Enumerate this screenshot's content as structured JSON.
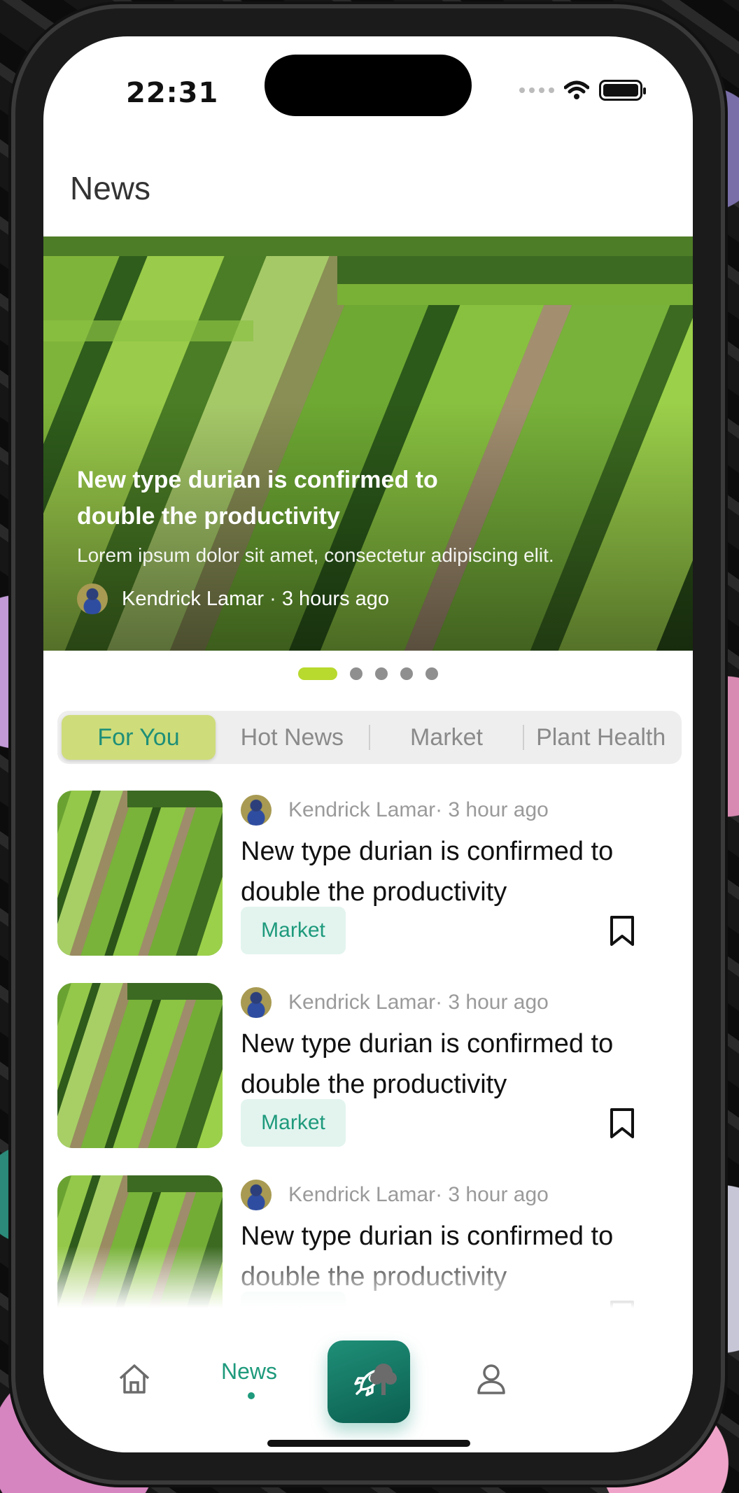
{
  "status": {
    "time": "22:31"
  },
  "header": {
    "title": "News"
  },
  "hero": {
    "title": "New type durian is confirmed to double the productivity",
    "subtitle": "Lorem ipsum dolor sit amet, consectetur adipiscing elit.",
    "byline": "Kendrick Lamar · 3 hours ago",
    "slide_count": 5,
    "active_slide": 1
  },
  "tabs": [
    "For You",
    "Hot News",
    "Market",
    "Plant Health"
  ],
  "articles": [
    {
      "meta": "Kendrick Lamar· 3 hour ago",
      "title": "New type durian is confirmed to double the productivity",
      "tag": "Market"
    },
    {
      "meta": "Kendrick Lamar· 3 hour ago",
      "title": "New type durian is confirmed to double the productivity",
      "tag": "Market"
    },
    {
      "meta": "Kendrick Lamar· 3 hour ago",
      "title": "New type durian is confirmed to double the productivity",
      "tag": "Market"
    }
  ],
  "nav": {
    "home_icon": "home-icon",
    "news_label": "News",
    "center_icon": "rocket-icon",
    "tree_icon": "tree-icon",
    "profile_icon": "profile-icon"
  },
  "colors": {
    "accent": "#1e9a7c",
    "tab_active_bg": "#cfdc7a",
    "dot_active": "#b8d92e",
    "tag_bg": "#e3f4ef"
  }
}
